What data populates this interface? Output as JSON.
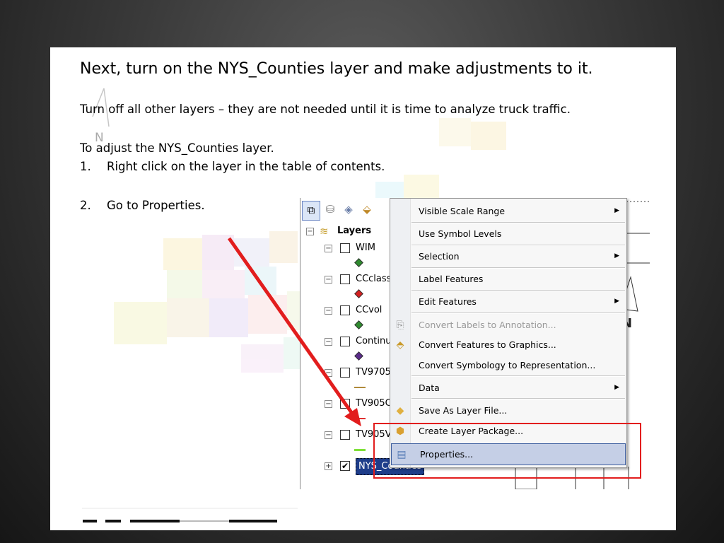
{
  "slide": {
    "title": "Next, turn on the NYS_Counties layer and make adjustments to it.",
    "line1": "Turn off all other layers – they are not needed until it is time to analyze truck traffic.",
    "line2": "To adjust the NYS_Counties layer.",
    "step1_num": "1.",
    "step1_text": "Right click on the layer in the table of contents.",
    "step2_num": "2.",
    "step2_text": "Go to Properties."
  },
  "toc": {
    "root_label": "Layers",
    "layers": [
      {
        "name": "WIM",
        "checked": false,
        "symbol": "diamond",
        "color": "#2e8b2e"
      },
      {
        "name": "CCclass",
        "checked": false,
        "symbol": "diamond",
        "color": "#d42020"
      },
      {
        "name": "CCvol",
        "checked": false,
        "symbol": "diamond",
        "color": "#2e8b2e"
      },
      {
        "name": "Continu",
        "checked": false,
        "symbol": "diamond",
        "color": "#5a2a8a"
      },
      {
        "name": "TV9705",
        "checked": false,
        "symbol": "line",
        "color": "#b08a3a"
      },
      {
        "name": "TV905C",
        "checked": false,
        "symbol": "line",
        "color": "#e03030"
      },
      {
        "name": "TV905V",
        "checked": false,
        "symbol": "line",
        "color": "#7fe03a"
      },
      {
        "name": "NYS_Counties",
        "checked": true,
        "symbol": "none",
        "color": "#1e3d8a"
      }
    ]
  },
  "context_menu": {
    "items": [
      {
        "label": "Visible Scale Range",
        "submenu": true,
        "icon": "",
        "disabled": false
      },
      {
        "label": "Use Symbol Levels",
        "submenu": false,
        "icon": "",
        "disabled": false
      },
      {
        "label": "Selection",
        "submenu": true,
        "icon": "",
        "disabled": false
      },
      {
        "label": "Label Features",
        "submenu": false,
        "icon": "",
        "disabled": false
      },
      {
        "label": "Edit Features",
        "submenu": true,
        "icon": "",
        "disabled": false
      },
      {
        "label": "Convert Labels to Annotation...",
        "submenu": false,
        "icon": "annotation-icon",
        "disabled": true
      },
      {
        "label": "Convert Features to Graphics...",
        "submenu": false,
        "icon": "graphics-icon",
        "disabled": false
      },
      {
        "label": "Convert Symbology to Representation...",
        "submenu": false,
        "icon": "",
        "disabled": false
      },
      {
        "label": "Data",
        "submenu": true,
        "icon": "",
        "disabled": false
      },
      {
        "label": "Save As Layer File...",
        "submenu": false,
        "icon": "layer-file-icon",
        "disabled": false
      },
      {
        "label": "Create Layer Package...",
        "submenu": false,
        "icon": "layer-package-icon",
        "disabled": false
      },
      {
        "label": "Properties...",
        "submenu": false,
        "icon": "properties-icon",
        "disabled": false,
        "highlighted": true
      }
    ]
  },
  "map": {
    "north_letter": "N"
  },
  "colors": {
    "annotation_red": "#e21d1d",
    "menu_highlight": "#c5cfe6"
  }
}
